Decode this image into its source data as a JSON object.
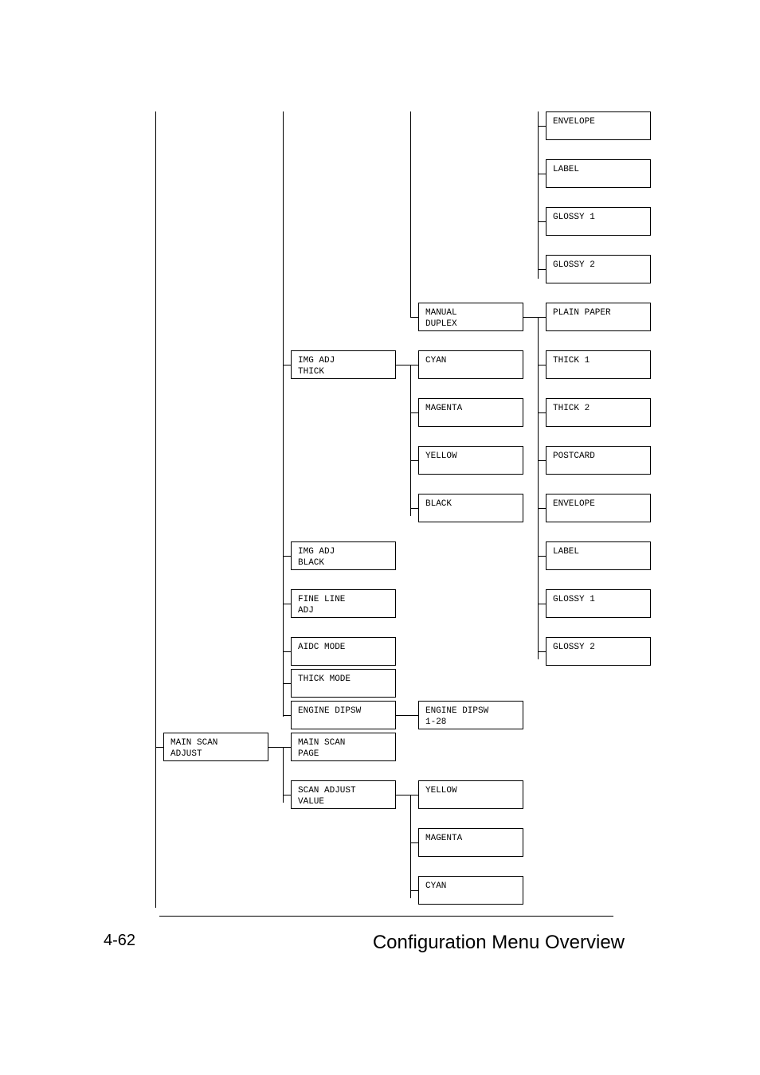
{
  "footer": {
    "page": "4-62",
    "title": "Configuration Menu Overview"
  },
  "col4": {
    "envelope": "ENVELOPE",
    "label": "LABEL",
    "glossy1": "GLOSSY 1",
    "glossy2": "GLOSSY 2",
    "plain_paper": "PLAIN PAPER",
    "thick1": "THICK 1",
    "thick2": "THICK 2",
    "postcard": "POSTCARD",
    "envelope2": "ENVELOPE",
    "label2": "LABEL",
    "glossy1b": "GLOSSY 1",
    "glossy2b": "GLOSSY 2"
  },
  "col3": {
    "manual_duplex": "MANUAL\nDUPLEX",
    "cyan": "CYAN",
    "magenta": "MAGENTA",
    "yellow": "YELLOW",
    "black": "BLACK",
    "engine_dipsw_n": "ENGINE DIPSW\n1-28",
    "yellow2": "YELLOW",
    "magenta2": "MAGENTA",
    "cyan2": "CYAN"
  },
  "col2": {
    "img_adj_thick": "IMG ADJ\nTHICK",
    "img_adj_black": "IMG ADJ\nBLACK",
    "fine_line_adj": "FINE LINE\nADJ",
    "aidc_mode": "AIDC MODE",
    "thick_mode": "THICK MODE",
    "engine_dipsw": "ENGINE DIPSW",
    "main_scan_page": "MAIN SCAN\nPAGE",
    "scan_adjust_value": "SCAN ADJUST\nVALUE"
  },
  "col1": {
    "main_scan_adjust": "MAIN SCAN\nADJUST"
  },
  "chart_data": {
    "type": "tree",
    "nodes": [
      {
        "col": 1,
        "label": "MAIN SCAN ADJUST",
        "children": [
          "MAIN SCAN PAGE",
          "SCAN ADJUST VALUE"
        ]
      },
      {
        "col": 2,
        "label": "IMG ADJ THICK",
        "children": [
          "CYAN",
          "MAGENTA",
          "YELLOW",
          "BLACK"
        ]
      },
      {
        "col": 2,
        "label": "IMG ADJ BLACK"
      },
      {
        "col": 2,
        "label": "FINE LINE ADJ"
      },
      {
        "col": 2,
        "label": "AIDC MODE"
      },
      {
        "col": 2,
        "label": "THICK MODE"
      },
      {
        "col": 2,
        "label": "ENGINE DIPSW",
        "children": [
          "ENGINE DIPSW 1-28"
        ]
      },
      {
        "col": 2,
        "label": "MAIN SCAN PAGE"
      },
      {
        "col": 2,
        "label": "SCAN ADJUST VALUE",
        "children": [
          "YELLOW",
          "MAGENTA",
          "CYAN"
        ]
      },
      {
        "col": 3,
        "label": "MANUAL DUPLEX",
        "children": [
          "PLAIN PAPER",
          "THICK 1",
          "THICK 2",
          "POSTCARD",
          "ENVELOPE",
          "LABEL",
          "GLOSSY 1",
          "GLOSSY 2"
        ]
      },
      {
        "col": 3,
        "label": "CYAN"
      },
      {
        "col": 3,
        "label": "MAGENTA"
      },
      {
        "col": 3,
        "label": "YELLOW"
      },
      {
        "col": 3,
        "label": "BLACK"
      },
      {
        "col": 3,
        "label": "ENGINE DIPSW 1-28"
      },
      {
        "col": 4,
        "label": "ENVELOPE"
      },
      {
        "col": 4,
        "label": "LABEL"
      },
      {
        "col": 4,
        "label": "GLOSSY 1"
      },
      {
        "col": 4,
        "label": "GLOSSY 2"
      },
      {
        "col": 4,
        "label": "PLAIN PAPER"
      },
      {
        "col": 4,
        "label": "THICK 1"
      },
      {
        "col": 4,
        "label": "THICK 2"
      },
      {
        "col": 4,
        "label": "POSTCARD"
      }
    ]
  }
}
